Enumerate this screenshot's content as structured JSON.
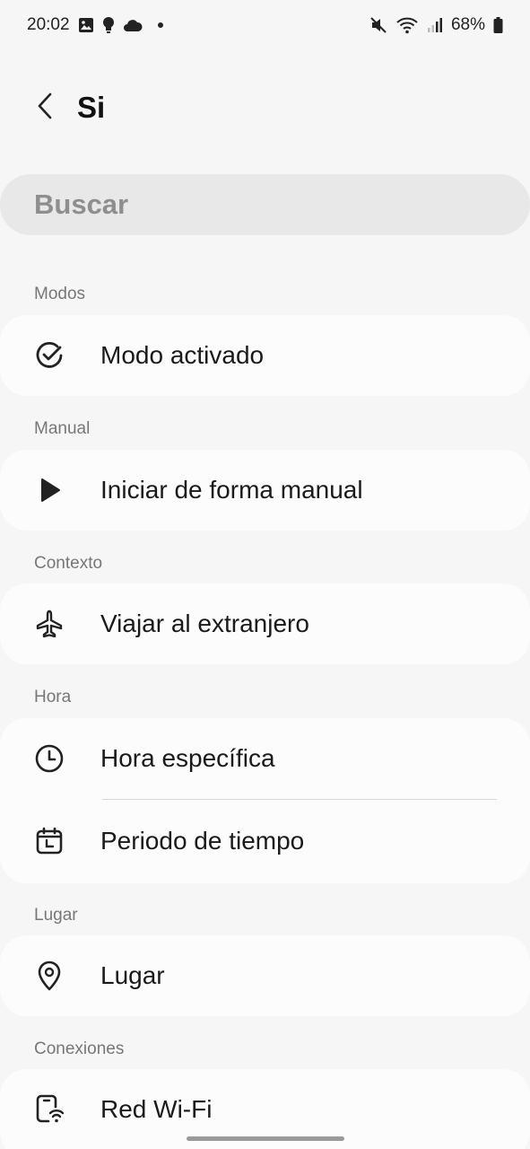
{
  "status_bar": {
    "time": "20:02",
    "battery": "68%",
    "icons": [
      "gallery-icon",
      "bulb-icon",
      "cloud-icon",
      "notification-dot",
      "mute-icon",
      "wifi-icon",
      "signal-icon",
      "battery-icon"
    ]
  },
  "header": {
    "title": "Si",
    "back_icon": "chevron-left-icon"
  },
  "search": {
    "placeholder": "Buscar"
  },
  "sections": [
    {
      "label": "Modos",
      "items": [
        {
          "label": "Modo activado",
          "icon": "check-circle-icon"
        }
      ]
    },
    {
      "label": "Manual",
      "items": [
        {
          "label": "Iniciar de forma manual",
          "icon": "play-icon"
        }
      ]
    },
    {
      "label": "Contexto",
      "items": [
        {
          "label": "Viajar al extranjero",
          "icon": "airplane-icon"
        }
      ]
    },
    {
      "label": "Hora",
      "items": [
        {
          "label": "Hora específica",
          "icon": "clock-icon"
        },
        {
          "label": "Periodo de tiempo",
          "icon": "calendar-icon"
        }
      ]
    },
    {
      "label": "Lugar",
      "items": [
        {
          "label": "Lugar",
          "icon": "location-pin-icon"
        }
      ]
    },
    {
      "label": "Conexiones",
      "items": [
        {
          "label": "Red Wi-Fi",
          "icon": "wifi-device-icon"
        }
      ]
    }
  ],
  "colors": {
    "background": "#f6f6f6",
    "card": "#fcfcfc",
    "search_bg": "#e8e8e8",
    "section_label": "#777777"
  }
}
